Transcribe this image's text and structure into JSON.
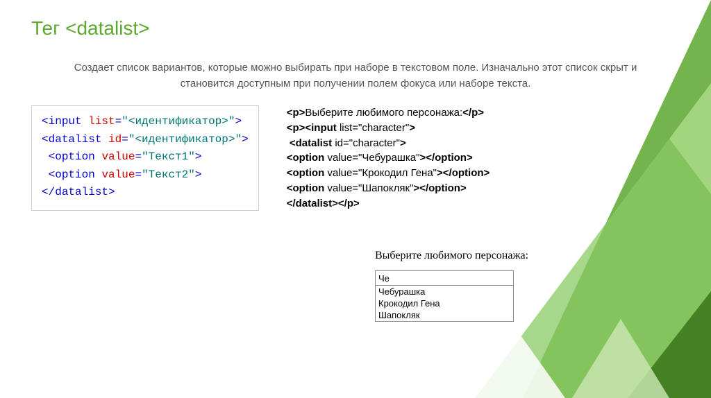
{
  "title": "Тег <datalist>",
  "description": "Создает список вариантов, которые можно выбирать при наборе в текстовом поле. Изначально этот список скрыт и становится доступным при получении полем фокуса или наборе текста.",
  "syntax": {
    "line1_tag": "input",
    "line1_attr": "list",
    "line1_val": "\"<идентификатор>\"",
    "line2_tag": "datalist",
    "line2_attr": "id",
    "line2_val": "\"<идентификатор>\"",
    "line3_tag": "option",
    "line3_attr": "value",
    "line3_val": "\"Текст1\"",
    "line4_tag": "option",
    "line4_attr": "value",
    "line4_val": "\"Текст2\"",
    "line5_tag": "/datalist"
  },
  "example": {
    "l1": "<p>Выберите любимого персонажа:</p>",
    "l2": "<p><input list=\"character\">",
    "l3": " <datalist id=\"character\">",
    "l4": "<option value=\"Чебурашка\"></option>",
    "l5": "<option value=\"Крокодил Гена\"></option>",
    "l6": "<option value=\"Шапокляк\"></option>",
    "l7": "</datalist></p>"
  },
  "demo": {
    "label": "Выберите любимого персонажа:",
    "input_value": "Че",
    "options": [
      "Чебурашка",
      "Крокодил Гена",
      "Шапокляк"
    ]
  }
}
